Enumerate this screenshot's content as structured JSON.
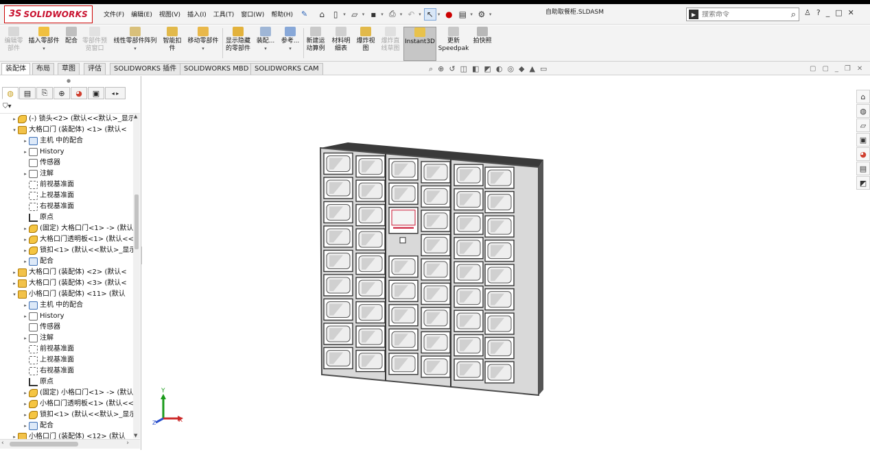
{
  "app": {
    "brand_mark": "3S",
    "brand_name": "SOLIDWORKS",
    "document_title": "自助取餐柜.SLDASM"
  },
  "menu": [
    "文件(F)",
    "编辑(E)",
    "视图(V)",
    "插入(I)",
    "工具(T)",
    "窗口(W)",
    "帮助(H)"
  ],
  "search": {
    "placeholder": "搜索命令"
  },
  "commands": [
    {
      "label": "编辑零部件",
      "l1": "编辑零",
      "l2": "部件",
      "enabled": false
    },
    {
      "label": "插入零部件",
      "l1": "插入零部件",
      "l2": "",
      "enabled": true
    },
    {
      "label": "配合",
      "l1": "配合",
      "l2": "",
      "enabled": true
    },
    {
      "label": "零部件预览窗口",
      "l1": "零部件预",
      "l2": "览窗口",
      "enabled": false
    },
    {
      "label": "线性零部件阵列",
      "l1": "线性零部件阵列",
      "l2": "",
      "enabled": true
    },
    {
      "label": "智能扣件",
      "l1": "智能扣",
      "l2": "件",
      "enabled": true
    },
    {
      "label": "移动零部件",
      "l1": "移动零部件",
      "l2": "",
      "enabled": true
    },
    {
      "label": "显示隐藏的零部件",
      "l1": "显示隐藏",
      "l2": "的零部件",
      "enabled": true
    },
    {
      "label": "装配",
      "l1": "装配...",
      "l2": "",
      "enabled": true
    },
    {
      "label": "参考",
      "l1": "参考...",
      "l2": "",
      "enabled": true
    },
    {
      "label": "新建运动算例",
      "l1": "新建运",
      "l2": "动算例",
      "enabled": true
    },
    {
      "label": "材料明细表",
      "l1": "材料明",
      "l2": "细表",
      "enabled": true
    },
    {
      "label": "爆炸视图",
      "l1": "爆炸视",
      "l2": "图",
      "enabled": true
    },
    {
      "label": "爆炸直线草图",
      "l1": "爆炸直",
      "l2": "线草图",
      "enabled": false
    },
    {
      "label": "Instant3D",
      "l1": "Instant3D",
      "l2": "",
      "enabled": true
    },
    {
      "label": "更新Speedpak",
      "l1": "更新",
      "l2": "Speedpak",
      "enabled": true
    },
    {
      "label": "拍快照",
      "l1": "拍快照",
      "l2": "",
      "enabled": true
    }
  ],
  "tabs": [
    "装配体",
    "布局",
    "草图",
    "评估",
    "SOLIDWORKS 插件",
    "SOLIDWORKS MBD",
    "SOLIDWORKS CAM"
  ],
  "tree": [
    {
      "text": "(-) 锁头<2> (默认<<默认>_显示",
      "icon": "part",
      "exp": "▸",
      "level": 1
    },
    {
      "text": "大格口门 (装配体) <1> (默认<",
      "icon": "asm",
      "exp": "▾",
      "level": 1
    },
    {
      "text": "主机 中的配合",
      "icon": "mate",
      "exp": "▸",
      "level": 2
    },
    {
      "text": "History",
      "icon": "folder",
      "exp": "▸",
      "level": 2
    },
    {
      "text": "传感器",
      "icon": "folder",
      "exp": "",
      "level": 2
    },
    {
      "text": "注解",
      "icon": "folder",
      "exp": "▸",
      "level": 2
    },
    {
      "text": "前视基准面",
      "icon": "plane",
      "exp": "",
      "level": 2
    },
    {
      "text": "上视基准面",
      "icon": "plane",
      "exp": "",
      "level": 2
    },
    {
      "text": "右视基准面",
      "icon": "plane",
      "exp": "",
      "level": 2
    },
    {
      "text": "原点",
      "icon": "origin",
      "exp": "",
      "level": 2
    },
    {
      "text": "(固定) 大格口门<1> -> (默认",
      "icon": "part",
      "exp": "▸",
      "level": 2
    },
    {
      "text": "大格口门透明板<1> (默认<<",
      "icon": "part",
      "exp": "▸",
      "level": 2
    },
    {
      "text": "锁扣<1> (默认<<默认>_显示",
      "icon": "part",
      "exp": "▸",
      "level": 2
    },
    {
      "text": "配合",
      "icon": "mate",
      "exp": "▸",
      "level": 2
    },
    {
      "text": "大格口门 (装配体) <2> (默认<",
      "icon": "asm",
      "exp": "▸",
      "level": 1
    },
    {
      "text": "大格口门 (装配体) <3> (默认<",
      "icon": "asm",
      "exp": "▸",
      "level": 1
    },
    {
      "text": "小格口门 (装配体) <11> (默认",
      "icon": "asm",
      "exp": "▾",
      "level": 1
    },
    {
      "text": "主机 中的配合",
      "icon": "mate",
      "exp": "▸",
      "level": 2
    },
    {
      "text": "History",
      "icon": "folder",
      "exp": "▸",
      "level": 2
    },
    {
      "text": "传感器",
      "icon": "folder",
      "exp": "",
      "level": 2
    },
    {
      "text": "注解",
      "icon": "folder",
      "exp": "▸",
      "level": 2
    },
    {
      "text": "前视基准面",
      "icon": "plane",
      "exp": "",
      "level": 2
    },
    {
      "text": "上视基准面",
      "icon": "plane",
      "exp": "",
      "level": 2
    },
    {
      "text": "右视基准面",
      "icon": "plane",
      "exp": "",
      "level": 2
    },
    {
      "text": "原点",
      "icon": "origin",
      "exp": "",
      "level": 2
    },
    {
      "text": "(固定) 小格口门<1> -> (默认",
      "icon": "part",
      "exp": "▸",
      "level": 2
    },
    {
      "text": "小格口门透明板<1> (默认<<",
      "icon": "part",
      "exp": "▸",
      "level": 2
    },
    {
      "text": "锁扣<1> (默认<<默认>_显示",
      "icon": "part",
      "exp": "▸",
      "level": 2
    },
    {
      "text": "配合",
      "icon": "mate",
      "exp": "▸",
      "level": 2
    },
    {
      "text": "小格口门 (装配体) <12> (默认",
      "icon": "asm",
      "exp": "▸",
      "level": 1
    }
  ],
  "triad": {
    "x": "X",
    "y": "Y",
    "z": "Z"
  },
  "colors": {
    "brand": "#c8102e",
    "background": "#f3f3f3",
    "viewport": "#ffffff",
    "cabinet_frame": "#4a4a4a",
    "door_fill": "#eeeeee"
  }
}
